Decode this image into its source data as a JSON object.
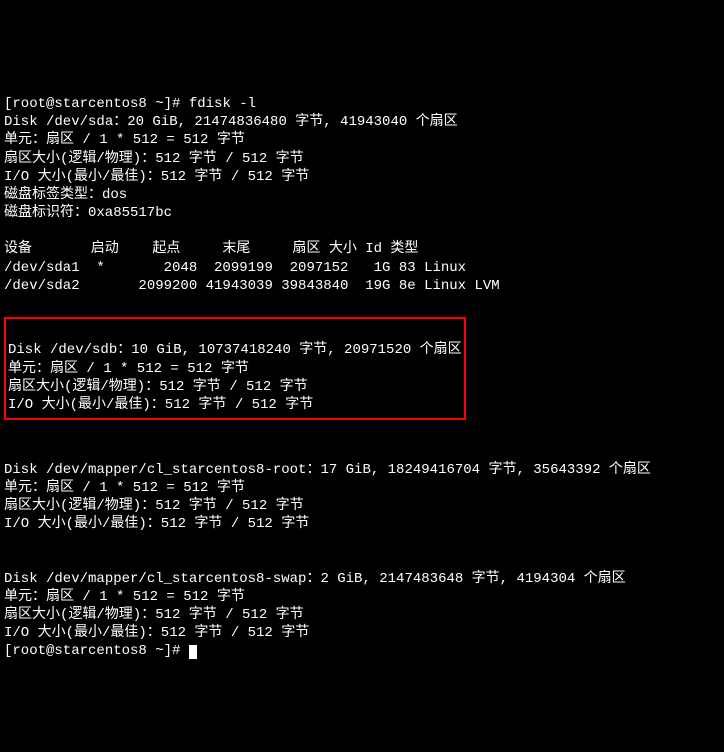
{
  "prompt1": "[root@starcentos8 ~]# ",
  "command": "fdisk -l",
  "disk_sda": {
    "header": "Disk /dev/sda：20 GiB, 21474836480 字节, 41943040 个扇区",
    "units": "单元：扇区 / 1 * 512 = 512 字节",
    "sector_size": "扇区大小(逻辑/物理)：512 字节 / 512 字节",
    "io_size": "I/O 大小(最小/最佳)：512 字节 / 512 字节",
    "label_type": "磁盘标签类型：dos",
    "identifier": "磁盘标识符：0xa85517bc"
  },
  "partition_header": "设备       启动    起点     末尾     扇区 大小 Id 类型",
  "partitions": [
    "/dev/sda1  *       2048  2099199  2097152   1G 83 Linux",
    "/dev/sda2       2099200 41943039 39843840  19G 8e Linux LVM"
  ],
  "disk_sdb": {
    "header": "Disk /dev/sdb：10 GiB, 10737418240 字节, 20971520 个扇区",
    "units": "单元：扇区 / 1 * 512 = 512 字节",
    "sector_size": "扇区大小(逻辑/物理)：512 字节 / 512 字节",
    "io_size": "I/O 大小(最小/最佳)：512 字节 / 512 字节"
  },
  "disk_mapper_root": {
    "header": "Disk /dev/mapper/cl_starcentos8-root：17 GiB, 18249416704 字节, 35643392 个扇区",
    "units": "单元：扇区 / 1 * 512 = 512 字节",
    "sector_size": "扇区大小(逻辑/物理)：512 字节 / 512 字节",
    "io_size": "I/O 大小(最小/最佳)：512 字节 / 512 字节"
  },
  "disk_mapper_swap": {
    "header": "Disk /dev/mapper/cl_starcentos8-swap：2 GiB, 2147483648 字节, 4194304 个扇区",
    "units": "单元：扇区 / 1 * 512 = 512 字节",
    "sector_size": "扇区大小(逻辑/物理)：512 字节 / 512 字节",
    "io_size": "I/O 大小(最小/最佳)：512 字节 / 512 字节"
  },
  "prompt2": "[root@starcentos8 ~]# "
}
